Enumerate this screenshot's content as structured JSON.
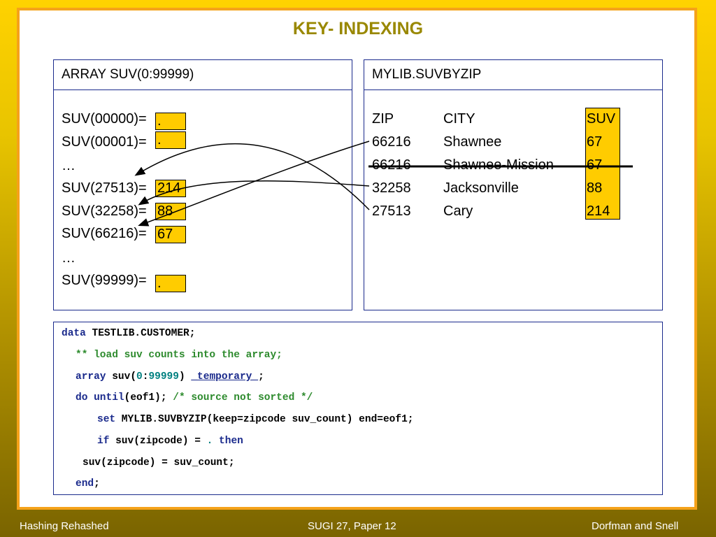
{
  "title": "KEY- INDEXING",
  "left_panel": {
    "header": "ARRAY SUV(0:99999)",
    "rows": [
      {
        "label": "SUV(00000)=",
        "value": "."
      },
      {
        "label": "SUV(00001)=",
        "value": "."
      },
      {
        "label": "…",
        "value": ""
      },
      {
        "label": "SUV(27513)=",
        "value": "214"
      },
      {
        "label": "SUV(32258)=",
        "value": "88"
      },
      {
        "label": "SUV(66216)=",
        "value": "67"
      },
      {
        "label": "…",
        "value": ""
      },
      {
        "label": "SUV(99999)=",
        "value": "."
      }
    ]
  },
  "right_panel": {
    "header": "MYLIB.SUVBYZIP",
    "columns": [
      "ZIP",
      "CITY",
      "SUV"
    ],
    "rows": [
      {
        "zip": "66216",
        "city": "Shawnee",
        "suv": "67",
        "struck": false
      },
      {
        "zip": "66216",
        "city": "Shawnee-Mission",
        "suv": "67",
        "struck": true
      },
      {
        "zip": "32258",
        "city": "Jacksonville",
        "suv": "88",
        "struck": false
      },
      {
        "zip": "27513",
        "city": "Cary",
        "suv": "214",
        "struck": false
      }
    ]
  },
  "code": {
    "l1_kw": "data",
    "l1_rest": " TESTLIB.CUSTOMER;",
    "l2_comment": "** load suv counts into the array;",
    "l3_kw": "array",
    "l3_a": " suv(",
    "l3_n1": "0",
    "l3_colon": ":",
    "l3_n2": "99999",
    "l3_b": ") ",
    "l3_temp": "_temporary_",
    "l3_end": ";",
    "l4_kw1": "do",
    "l4_sp": " ",
    "l4_kw2": "until",
    "l4_a": "(eof1); ",
    "l4_comment": "/* source not sorted */",
    "l5_kw": "set",
    "l5_rest": " MYLIB.SUVBYZIP(keep=zipcode suv_count) end=eof1;",
    "l6_kw": "if",
    "l6_a": " suv(zipcode) = ",
    "l6_dot": ".",
    "l6_sp": " ",
    "l6_then": "then",
    "l7": "suv(zipcode) = suv_count;",
    "l8_kw": "end",
    "l8_end": ";"
  },
  "footer": {
    "left": "Hashing Rehashed",
    "center": "SUGI 27, Paper 12",
    "right": "Dorfman and Snell"
  },
  "colors": {
    "accent": "#f5a21a",
    "highlight": "#ffcc00",
    "border": "#1a2a8c",
    "title": "#998800",
    "keyword": "#1a2a8c",
    "comment": "#2e8b2e"
  }
}
